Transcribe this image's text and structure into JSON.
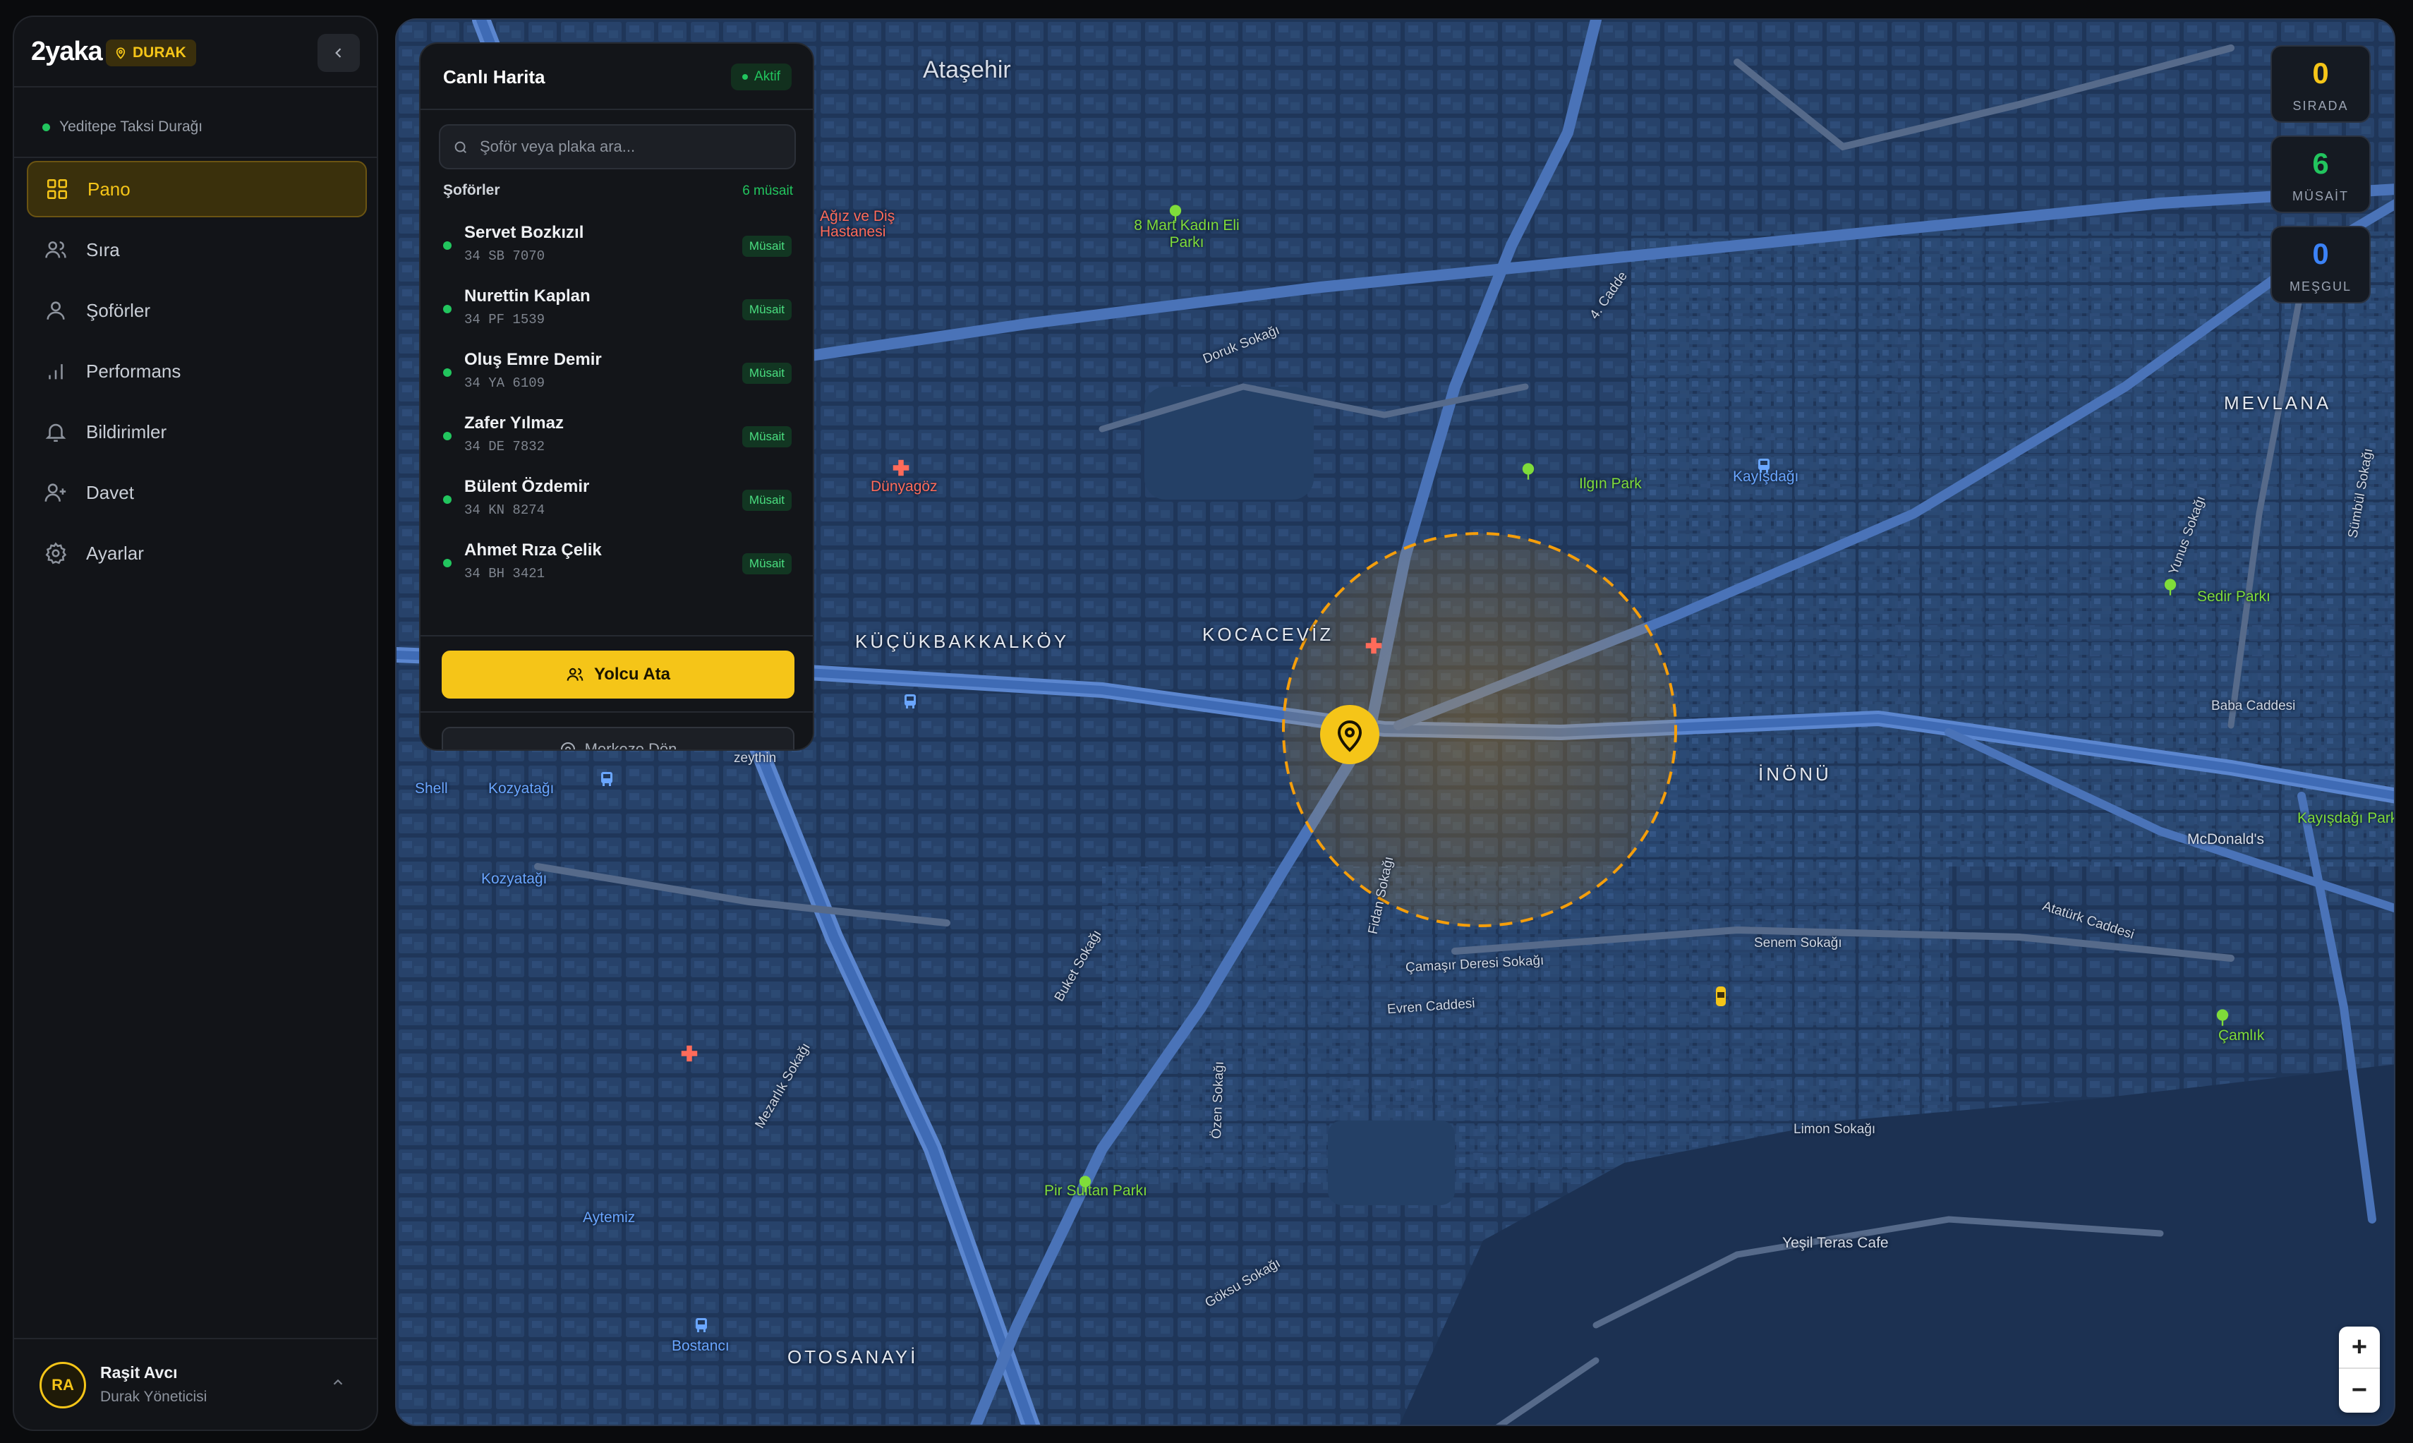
{
  "sidebar": {
    "logo": "2yaka",
    "badge": "DURAK",
    "stand_name": "Yeditepe Taksi Durağı",
    "items": [
      {
        "label": "Pano",
        "icon": "grid-icon",
        "active": true
      },
      {
        "label": "Sıra",
        "icon": "users-icon"
      },
      {
        "label": "Şoförler",
        "icon": "user-icon"
      },
      {
        "label": "Performans",
        "icon": "bar-chart-icon"
      },
      {
        "label": "Bildirimler",
        "icon": "bell-icon"
      },
      {
        "label": "Davet",
        "icon": "user-plus-icon"
      },
      {
        "label": "Ayarlar",
        "icon": "gear-icon"
      }
    ],
    "user": {
      "initials": "RA",
      "name": "Raşit Avcı",
      "role": "Durak Yöneticisi"
    }
  },
  "panel": {
    "title": "Canlı Harita",
    "status": "Aktif",
    "search_placeholder": "Şoför veya plaka ara...",
    "section_title": "Şoförler",
    "available_count": "6 müsait",
    "drivers": [
      {
        "name": "Servet Bozkızıl",
        "plate": "34 SB 7070",
        "status": "Müsait"
      },
      {
        "name": "Nurettin Kaplan",
        "plate": "34 PF 1539",
        "status": "Müsait"
      },
      {
        "name": "Oluş Emre Demir",
        "plate": "34 YA 6109",
        "status": "Müsait"
      },
      {
        "name": "Zafer Yılmaz",
        "plate": "34 DE 7832",
        "status": "Müsait"
      },
      {
        "name": "Bülent Özdemir",
        "plate": "34 KN 8274",
        "status": "Müsait"
      },
      {
        "name": "Ahmet Rıza Çelik",
        "plate": "34 BH 3421",
        "status": "Müsait"
      }
    ],
    "assign_button": "Yolcu Ata",
    "center_button": "Merkeze Dön"
  },
  "stats": [
    {
      "value": "0",
      "label": "SIRADA",
      "color": "#f5c518"
    },
    {
      "value": "6",
      "label": "MÜSAİT",
      "color": "#22c55e"
    },
    {
      "value": "0",
      "label": "MEŞGUL",
      "color": "#3b82f6"
    }
  ],
  "map": {
    "labels": {
      "atasehir": "Ataşehir",
      "mevlana": "MEVLANA",
      "kucukbakkalkoy": "KÜÇÜKBAKKALKÖY",
      "kocaeviz": "KOCACEVİZ",
      "inonu": "İNÖNÜ",
      "otosanayi": "OTOSANAYİ",
      "dunyagoz": "Dünyagöz",
      "agiz_dis": "Ağız ve Diş Hastanesi",
      "mart_parki": "8 Mart Kadın Eli Parkı",
      "ilgin_park": "Ilgın Park",
      "kayisdagi": "Kayışdağı",
      "sedir_parki": "Sedir Parkı",
      "baba_caddesi": "Baba Caddesi",
      "mcdonalds": "McDonald's",
      "kayisdagi_park": "Kayışdağı Park",
      "ataturk_caddesi": "Atatürk Caddesi",
      "senem_sokagi": "Senem Sokağı",
      "camasir": "Çamaşır Deresi Sokağı",
      "evren": "Evren Caddesi",
      "camlik": "Çamlık",
      "limon": "Limon Sokağı",
      "yesil_teras": "Yeşil Teras Cafe",
      "pir_sultan": "Pir Sultan Parkı",
      "shell": "Shell",
      "kozyatagi1": "Kozyatağı",
      "kozyatagi2": "Kozyatağı",
      "zeythin": "zeythin",
      "aytemiz": "Aytemiz",
      "bostanci": "Bostancı",
      "doruk": "Doruk Sokağı",
      "cadde4": "4. Cadde",
      "buket": "Buket Sokağı",
      "mezarlik": "Mezarlık Sokağı",
      "ozen": "Özen Sokağı",
      "goksu": "Göksu Sokağı",
      "yunus": "Yunus Sokağı",
      "sumbul": "Sümbül Sokağı",
      "fidan": "Fidan Sokağı"
    },
    "zoom_in": "+",
    "zoom_out": "−"
  },
  "colors": {
    "accent": "#f5c518",
    "success": "#22c55e",
    "info": "#3b82f6",
    "map_bg": "#1e3457"
  }
}
